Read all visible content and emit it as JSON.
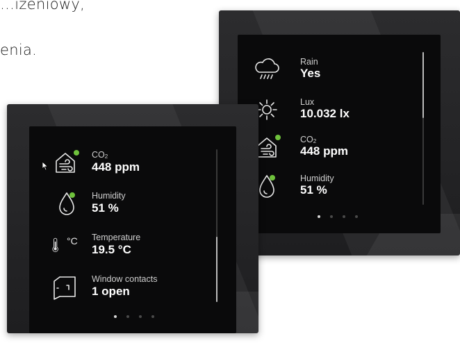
{
  "background_text": {
    "line1": "…izeniowy,",
    "line2": "enia."
  },
  "colors": {
    "panel_frame": "#2a2a2c",
    "screen_bg": "#0a0a0b",
    "status_green": "#6fc23c",
    "text_primary": "#ffffff",
    "text_secondary": "#cfcfcf"
  },
  "back_panel": {
    "items": [
      {
        "icon": "cloud-rain-icon",
        "label": "Rain",
        "value": "Yes"
      },
      {
        "icon": "sun-icon",
        "label": "Lux",
        "value": "10.032 lx"
      },
      {
        "icon": "house-wind-icon",
        "label_main": "CO",
        "label_sub": "2",
        "value": "448 ppm",
        "status": "green"
      },
      {
        "icon": "droplet-icon",
        "label": "Humidity",
        "value": "51 %",
        "status": "green"
      }
    ],
    "page_indicator": {
      "count": 4,
      "active": 1
    },
    "scroll_position": 0.0
  },
  "front_panel": {
    "items": [
      {
        "icon": "house-wind-icon",
        "label_main": "CO",
        "label_sub": "2",
        "value": "448 ppm",
        "status": "green"
      },
      {
        "icon": "droplet-icon",
        "label": "Humidity",
        "value": "51 %",
        "status": "green"
      },
      {
        "icon": "thermometer-icon",
        "icon_text": "°C",
        "label": "Temperature",
        "value": "19.5 °C"
      },
      {
        "icon": "window-icon",
        "label": "Window contacts",
        "value": "1 open"
      }
    ],
    "page_indicator": {
      "count": 4,
      "active": 1
    },
    "scroll_position": 1.0
  }
}
